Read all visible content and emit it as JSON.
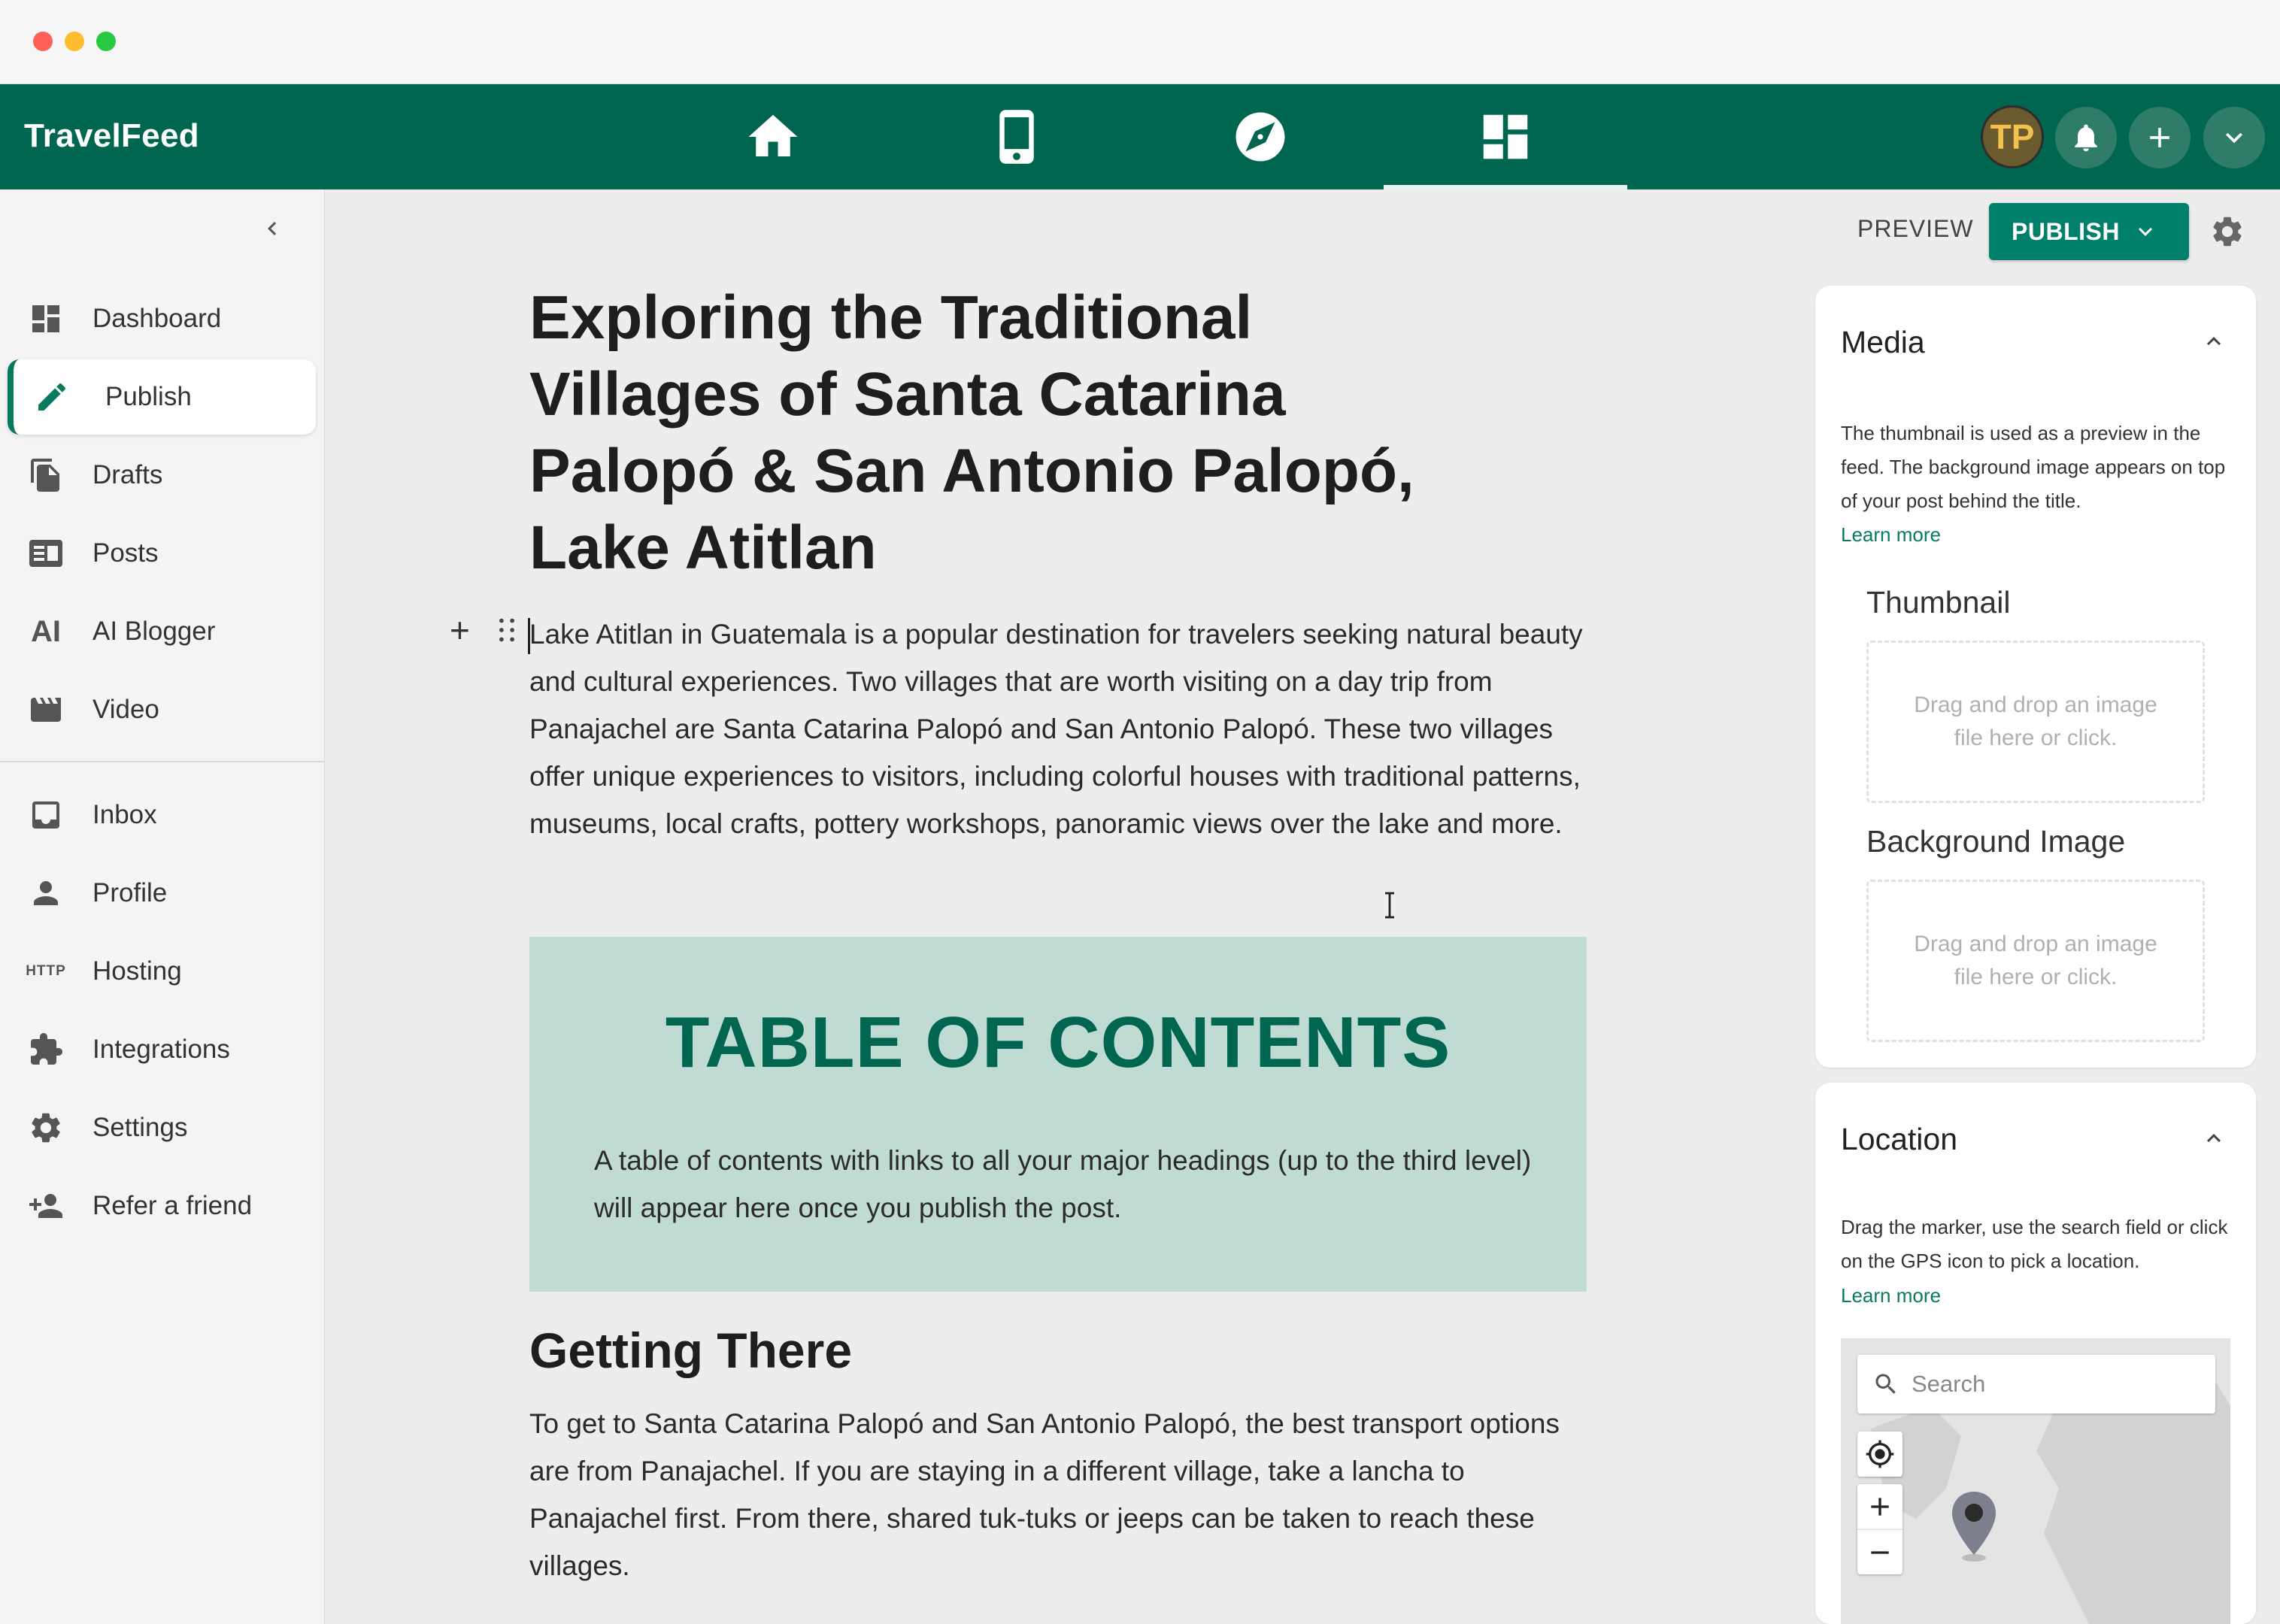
{
  "window": {
    "controls": [
      "close",
      "minimize",
      "zoom"
    ]
  },
  "app": {
    "brand": "TravelFeed",
    "nav_icons": [
      "home-icon",
      "phone-icon",
      "compass-icon",
      "dashboard-icon"
    ],
    "active_nav": "dashboard-icon",
    "avatar_initials": "TP",
    "header_actions": [
      "bell-icon",
      "plus-icon",
      "chevron-down-icon"
    ]
  },
  "sidebar": {
    "items": [
      {
        "label": "Dashboard",
        "icon": "dashboard-icon"
      },
      {
        "label": "Publish",
        "icon": "pencil-icon",
        "active": true
      },
      {
        "label": "Drafts",
        "icon": "drafts-icon"
      },
      {
        "label": "Posts",
        "icon": "posts-icon"
      },
      {
        "label": "AI Blogger",
        "icon": "ai-icon",
        "icon_text": "AI"
      },
      {
        "label": "Video",
        "icon": "video-icon"
      },
      {
        "label": "Inbox",
        "icon": "inbox-icon"
      },
      {
        "label": "Profile",
        "icon": "person-icon"
      },
      {
        "label": "Hosting",
        "icon": "http-icon",
        "icon_text": "HTTP"
      },
      {
        "label": "Integrations",
        "icon": "puzzle-icon"
      },
      {
        "label": "Settings",
        "icon": "gear-icon"
      },
      {
        "label": "Refer a friend",
        "icon": "person-add-icon"
      }
    ]
  },
  "toolbar": {
    "preview_label": "PREVIEW",
    "publish_label": "PUBLISH"
  },
  "editor": {
    "title": "Exploring the Traditional Villages of Santa Catarina Palopó & San Antonio Palopó, Lake Atitlan",
    "intro": "Lake Atitlan in Guatemala is a popular destination for travelers seeking natural beauty and cultural experiences. Two villages that are worth visiting on a day trip from Panajachel are Santa Catarina Palopó and San Antonio Palopó. These two villages offer unique experiences to visitors, including colorful houses with traditional patterns, museums, local crafts, pottery workshops, panoramic views over the lake and more.",
    "toc_title": "TABLE OF CONTENTS",
    "toc_text": "A table of contents with links to all your major headings (up to the third level) will appear here once you publish the post.",
    "heading_1": "Getting There",
    "para_2": "To get to Santa Catarina Palopó and San Antonio Palopó, the best transport options are from Panajachel. If you are staying in a different village, take a lancha to Panajachel first. From there, shared tuk-tuks or jeeps can be taken to reach these villages."
  },
  "media_panel": {
    "title": "Media",
    "description": "The thumbnail is used as a preview in the feed. The background image appears on top of your post behind the title.",
    "learn_more": "Learn more",
    "thumbnail_label": "Thumbnail",
    "thumbnail_drop": "Drag and drop an image file here or click.",
    "background_label": "Background Image",
    "background_drop": "Drag and drop an image file here or click."
  },
  "location_panel": {
    "title": "Location",
    "description": "Drag the marker, use the search field or click on the GPS icon to pick a location.",
    "learn_more": "Learn more",
    "search_placeholder": "Search"
  },
  "colors": {
    "brand_green": "#00664f",
    "publish_green": "#00806a",
    "toc_background": "#bfdbd4",
    "link": "#0a7a5e"
  }
}
